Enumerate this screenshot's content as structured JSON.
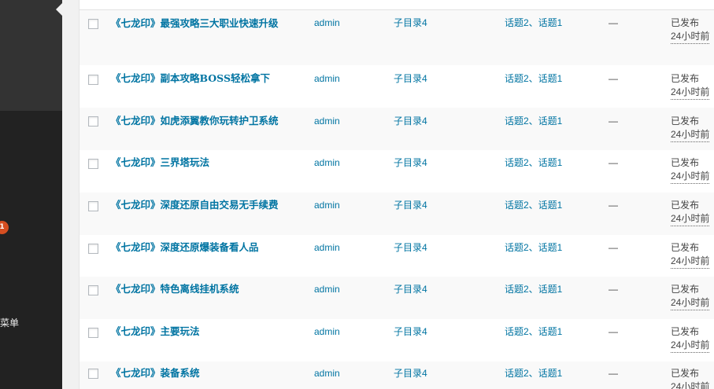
{
  "sidebar": {
    "badge_count": "1",
    "partial_label": "菜单"
  },
  "posts": [
    {
      "title": "《七龙印》最强攻略三大职业快速升级",
      "author": "admin",
      "category": "子目录4",
      "tags": "话题2、话题1",
      "comments": "—",
      "status": "已发布",
      "date": "24小时前"
    },
    {
      "title": "《七龙印》副本攻略BOSS轻松拿下",
      "author": "admin",
      "category": "子目录4",
      "tags": "话题2、话题1",
      "comments": "—",
      "status": "已发布",
      "date": "24小时前"
    },
    {
      "title": "《七龙印》如虎添翼教你玩转护卫系统",
      "author": "admin",
      "category": "子目录4",
      "tags": "话题2、话题1",
      "comments": "—",
      "status": "已发布",
      "date": "24小时前"
    },
    {
      "title": "《七龙印》三界塔玩法",
      "author": "admin",
      "category": "子目录4",
      "tags": "话题2、话题1",
      "comments": "—",
      "status": "已发布",
      "date": "24小时前"
    },
    {
      "title": "《七龙印》深度还原自由交易无手续费",
      "author": "admin",
      "category": "子目录4",
      "tags": "话题2、话题1",
      "comments": "—",
      "status": "已发布",
      "date": "24小时前"
    },
    {
      "title": "《七龙印》深度还原爆装备看人品",
      "author": "admin",
      "category": "子目录4",
      "tags": "话题2、话题1",
      "comments": "—",
      "status": "已发布",
      "date": "24小时前"
    },
    {
      "title": "《七龙印》特色离线挂机系统",
      "author": "admin",
      "category": "子目录4",
      "tags": "话题2、话题1",
      "comments": "—",
      "status": "已发布",
      "date": "24小时前"
    },
    {
      "title": "《七龙印》主要玩法",
      "author": "admin",
      "category": "子目录4",
      "tags": "话题2、话题1",
      "comments": "—",
      "status": "已发布",
      "date": "24小时前"
    },
    {
      "title": "《七龙印》装备系统",
      "author": "admin",
      "category": "子目录4",
      "tags": "话题2、话题1",
      "comments": "—",
      "status": "已发布",
      "date": "24小时前"
    }
  ],
  "colors": {
    "link": "#0074a2",
    "sidebar": "#222222",
    "badge": "#d54e21"
  }
}
